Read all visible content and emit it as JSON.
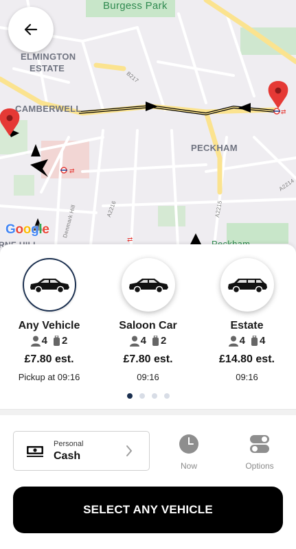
{
  "map": {
    "labels": {
      "burgess_park": "Burgess Park",
      "elmington_1": "ELMINGTON",
      "elmington_2": "ESTATE",
      "camberwell": "CAMBERWELL",
      "peckham": "PECKHAM",
      "b217": "B217",
      "a2216": "A2216",
      "a2215": "A2215",
      "a2214": "A2214",
      "denmark_hill": "Denmark Hill",
      "peckham_rye": "Peckham",
      "ne_hill": "RNE HILL"
    },
    "google": [
      "G",
      "o",
      "o",
      "g",
      "l",
      "e"
    ],
    "route_color": "#000000",
    "pin_color": "#e53935"
  },
  "back_button": {
    "icon": "arrow-left-icon"
  },
  "vehicles": [
    {
      "name": "Any Vehicle",
      "passengers": "4",
      "luggage": "2",
      "price": "£7.80 est.",
      "time": "Pickup at 09:16",
      "selected": true
    },
    {
      "name": "Saloon Car",
      "passengers": "4",
      "luggage": "2",
      "price": "£7.80 est.",
      "time": "09:16",
      "selected": false
    },
    {
      "name": "Estate",
      "passengers": "4",
      "luggage": "4",
      "price": "£14.80 est.",
      "time": "09:16",
      "selected": false
    }
  ],
  "pager": {
    "count": 4,
    "active_index": 0
  },
  "payment": {
    "subtitle": "Personal",
    "method": "Cash",
    "icon": "cash-icon"
  },
  "options": {
    "now_label": "Now",
    "options_label": "Options"
  },
  "select_button": {
    "label": "SELECT ANY VEHICLE"
  },
  "colors": {
    "accent": "#1a2f4f",
    "button_bg": "#000000"
  }
}
